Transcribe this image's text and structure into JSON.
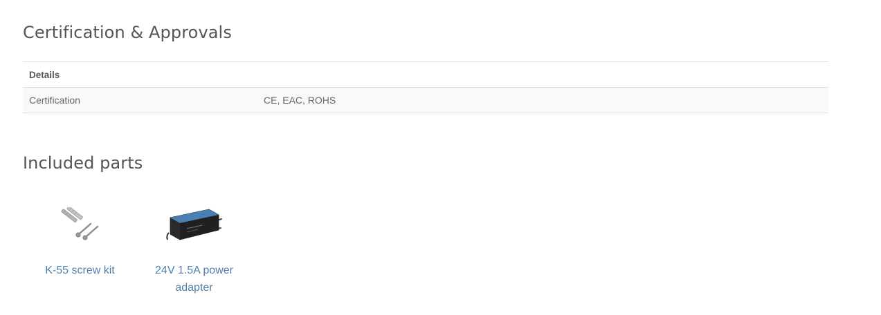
{
  "certification": {
    "title": "Certification & Approvals",
    "table": {
      "header": "Details",
      "rows": [
        {
          "label": "Certification",
          "value": "CE, EAC, ROHS"
        }
      ]
    }
  },
  "included_parts": {
    "title": "Included parts",
    "items": [
      {
        "label": "K-55 screw kit",
        "icon": "screw-kit-image"
      },
      {
        "label": "24V 1.5A power adapter",
        "icon": "power-adapter-image"
      }
    ]
  },
  "colors": {
    "link": "#4f7fab",
    "heading": "#555555",
    "row_background": "#f9f9f9",
    "border": "#dddddd"
  }
}
